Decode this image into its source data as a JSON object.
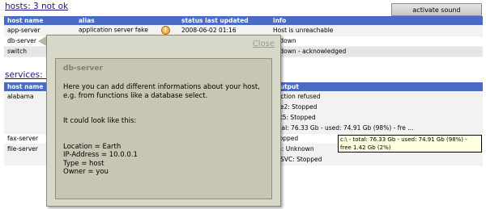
{
  "hosts": {
    "title": "hosts: 3 not ok",
    "activate_button": "activate sound",
    "columns": [
      "host name",
      "alias",
      "status last updated",
      "info"
    ],
    "rows": [
      {
        "name": "app-server",
        "alias": "application server fake",
        "updated": "2008-06-02 01:16",
        "info": "Host is unreachable",
        "warning_icon": "!"
      },
      {
        "name": "db-server",
        "alias": "",
        "updated": "",
        "info": "is down"
      },
      {
        "name": "switch",
        "alias": "",
        "updated": "",
        "info": "is down - acknowledged"
      }
    ]
  },
  "services": {
    "title": "services: 7",
    "columns": [
      "host name",
      "",
      "",
      "k output"
    ],
    "rows": [
      {
        "host": "alabama",
        "output": "nection refused"
      },
      {
        "host": "",
        "output": "che2: Stopped"
      },
      {
        "host": "",
        "output": "kat5: Stopped"
      },
      {
        "host": "",
        "output": "total: 76.33 Gb - used: 74.91 Gb (98%) - fre ..."
      },
      {
        "host": "fax-server",
        "output": "Stopped"
      },
      {
        "host": "file-server",
        "output": "illa: Unknown"
      },
      {
        "host": "",
        "output": "TPSVC: Stopped"
      }
    ]
  },
  "popup": {
    "close_label": "Close",
    "title": "db-server",
    "lines": [
      "Here you can add different informations about your host,",
      "e.g. from functions like a database select.",
      "",
      "",
      "It could look like this:",
      "",
      "",
      "Location = Earth",
      "IP-Address = 10.0.0.1",
      "Type = host",
      "Owner = you"
    ]
  },
  "tooltip": {
    "text": "c:\\ - total: 76.33 Gb - used: 74.91 Gb (98%) - free 1.42 Gb (2%)"
  },
  "colors": {
    "header_bg": "#4a6bc5",
    "title_link": "#1a1a80",
    "popup_bg": "#d8d8c8",
    "popup_inner_bg": "#c6c6b3",
    "tooltip_bg": "#ffffe1"
  }
}
